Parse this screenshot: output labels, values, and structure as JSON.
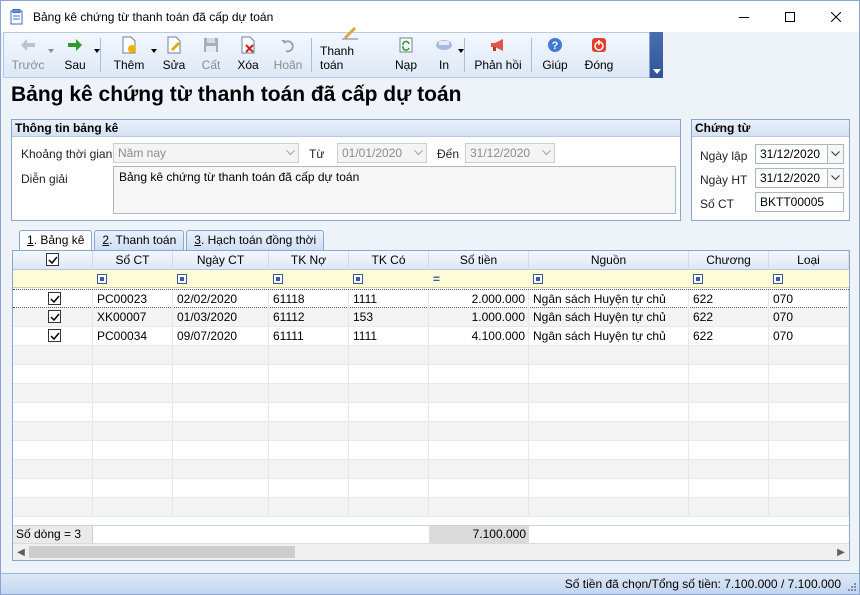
{
  "window": {
    "title": "Bảng kê chứng từ thanh toán đã cấp dự toán",
    "controls": [
      "minimize-icon",
      "maximize-icon",
      "close-icon"
    ]
  },
  "toolbar": {
    "prev_label": "Trước",
    "next_label": "Sau",
    "add_label": "Thêm",
    "edit_label": "Sửa",
    "save_label": "Cất",
    "delete_label": "Xóa",
    "undo_label": "Hoãn",
    "pay_label": "Thanh toán",
    "load_label": "Nạp",
    "print_label": "In",
    "feedback_label": "Phản hồi",
    "help_label": "Giúp",
    "close_label": "Đóng"
  },
  "page_title": "Bảng kê chứng từ thanh toán đã cấp dự toán",
  "info": {
    "header": "Thông tin bảng kê",
    "period_label": "Khoảng thời gian",
    "period_value": "Năm nay",
    "from_label": "Từ",
    "from_value": "01/01/2020",
    "to_label": "Đến",
    "to_value": "31/12/2020",
    "desc_label": "Diễn giải",
    "desc_value": "Bảng kê chứng từ thanh toán đã cấp dự toán"
  },
  "voucher": {
    "header": "Chứng từ",
    "date_label": "Ngày lập",
    "date_value": "31/12/2020",
    "post_label": "Ngày HT",
    "post_value": "31/12/2020",
    "no_label": "Số CT",
    "no_value": "BKTT00005"
  },
  "tabs": [
    {
      "key": "1",
      "label": ". Bảng kê"
    },
    {
      "key": "2",
      "label": ". Thanh toán"
    },
    {
      "key": "3",
      "label": ". Hạch toán đồng thời"
    }
  ],
  "grid": {
    "columns": [
      "Số CT",
      "Ngày CT",
      "TK Nợ",
      "TK Có",
      "Số tiền",
      "Nguồn",
      "Chương",
      "Loại"
    ],
    "rows": [
      {
        "checked": true,
        "so_ct": "PC00023",
        "ngay_ct": "02/02/2020",
        "tk_no": "61118",
        "tk_co": "1111",
        "so_tien": "2.000.000",
        "nguon": "Ngân sách Huyện tự chủ",
        "chuong": "622",
        "loai": "070"
      },
      {
        "checked": true,
        "so_ct": "XK00007",
        "ngay_ct": "01/03/2020",
        "tk_no": "61112",
        "tk_co": "153",
        "so_tien": "1.000.000",
        "nguon": "Ngân sách Huyện tự chủ",
        "chuong": "622",
        "loai": "070"
      },
      {
        "checked": true,
        "so_ct": "PC00034",
        "ngay_ct": "09/07/2020",
        "tk_no": "61111",
        "tk_co": "1111",
        "so_tien": "4.100.000",
        "nguon": "Ngân sách Huyện tự chủ",
        "chuong": "622",
        "loai": "070"
      }
    ],
    "footer_count": "Số dòng = 3",
    "footer_total": "7.100.000"
  },
  "status": {
    "text": "Số tiền đã chọn/Tổng số tiền: 7.100.000 / 7.100.000"
  }
}
